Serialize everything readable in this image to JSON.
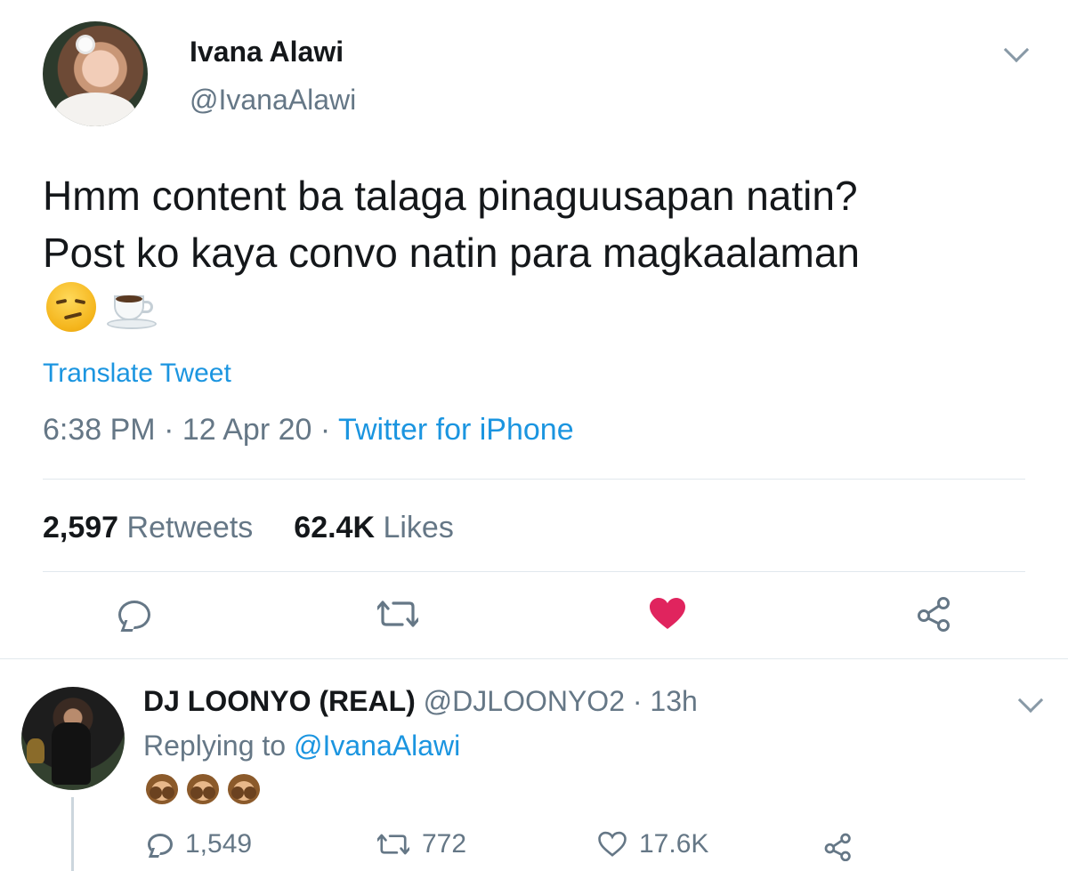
{
  "tweet": {
    "author_name": "Ivana Alawi",
    "author_handle": "@IvanaAlawi",
    "text_line1": "Hmm content ba talaga pinaguusapan natin?",
    "text_line2": "Post ko kaya convo natin para magkaalaman",
    "emojis": [
      "smirking-face-emoji",
      "hot-beverage-emoji"
    ],
    "translate_label": "Translate Tweet",
    "time": "6:38 PM",
    "date": "12 Apr 20",
    "separator": "·",
    "source": "Twitter for iPhone",
    "retweets_count": "2,597",
    "retweets_label": "Retweets",
    "likes_count": "62.4K",
    "likes_label": "Likes",
    "liked": true,
    "like_color": "#e0245e"
  },
  "reply": {
    "author_name": "DJ LOONYO (REAL)",
    "author_handle": "@DJLOONYO2",
    "age": "13h",
    "separator": "·",
    "replying_label": "Replying to",
    "replying_to": "@IvanaAlawi",
    "emojis": [
      "speak-no-evil-monkey-emoji",
      "speak-no-evil-monkey-emoji",
      "speak-no-evil-monkey-emoji"
    ],
    "reply_count": "1,549",
    "retweet_count": "772",
    "like_count": "17.6K"
  },
  "colors": {
    "link": "#1b95e0",
    "muted": "#657786",
    "text": "#14171a",
    "divider": "#e1e8ed"
  }
}
